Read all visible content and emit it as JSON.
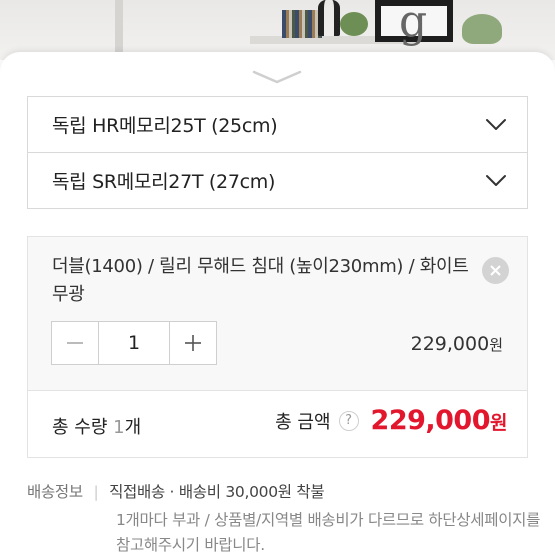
{
  "options": [
    {
      "label": "독립 HR메모리25T (25cm)"
    },
    {
      "label": "독립 SR메모리27T (27cm)"
    }
  ],
  "selected_option": {
    "name": "더블(1400) / 릴리 무해드 침대 (높이230mm) / 화이트무광",
    "quantity": "1",
    "price": "229,000",
    "currency": "원",
    "minus_icon": "minus-icon",
    "plus_icon": "plus-icon",
    "remove_icon": "close-icon"
  },
  "total": {
    "qty_label": "총 수량",
    "qty_value": "1",
    "qty_unit": "개",
    "amount_label": "총 금액",
    "help_glyph": "?",
    "amount": "229,000",
    "currency": "원"
  },
  "shipping": {
    "label": "배송정보",
    "method": "직접배송",
    "bullet": "·",
    "fee": "배송비 30,000원 착불",
    "note": "1개마다 부과 / 상품별/지역별 배송비가 다르므로 하단상세페이지를 참고해주시기 바랍니다."
  },
  "colors": {
    "accent_price": "#e2162c"
  },
  "photo_letter": "g"
}
